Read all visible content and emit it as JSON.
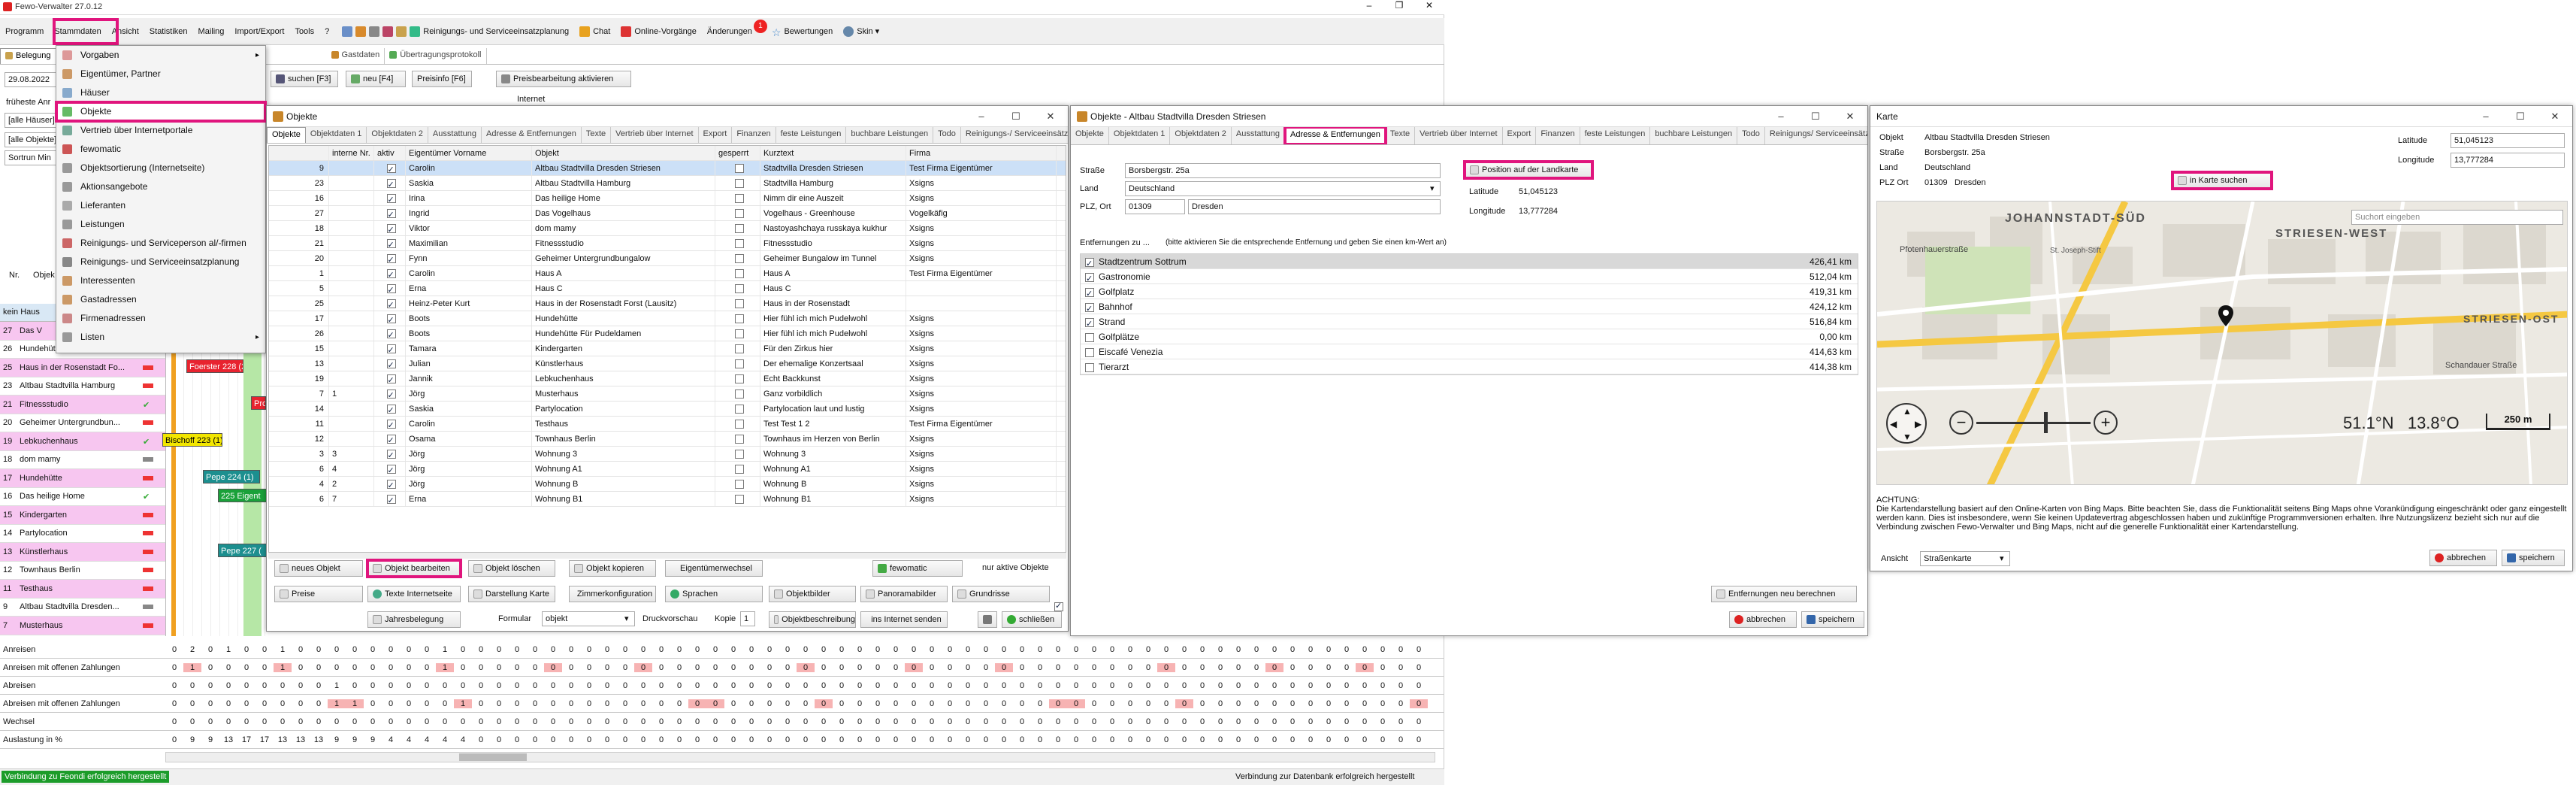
{
  "app": {
    "title": "Fewo-Verwalter 27.0.12"
  },
  "menubar": {
    "items": [
      "Programm",
      "Stammdaten",
      "Ansicht",
      "Statistiken",
      "Mailing",
      "Import/Export",
      "Tools",
      "?"
    ],
    "right": [
      "Reinigungs- und Serviceeinsatzplanung",
      "Chat",
      "Online-Vorgänge",
      "Änderungen",
      "Bewertungen",
      "Skin"
    ],
    "changes_badge": "1"
  },
  "stammdaten_menu": {
    "items": [
      "Vorgaben",
      "Eigentümer, Partner",
      "Häuser",
      "Objekte",
      "Vertrieb über Internetportale",
      "fewomatic",
      "Objektsortierung (Internetseite)",
      "Aktionsangebote",
      "Lieferanten",
      "Leistungen",
      "Reinigungs- und Serviceperson al/-firmen",
      "Reinigungs- und Serviceeinsatzplanung",
      "Interessenten",
      "Gastadressen",
      "Firmenadressen",
      "Listen"
    ]
  },
  "main": {
    "tabs": [
      "Belegung",
      "Gastdaten",
      "Übertragungsprotokoll"
    ],
    "toolbar": {
      "search": "suchen [F3]",
      "new": "neu [F4]",
      "prices": "Preisinfo [F6]",
      "price_edit": "Preisbearbeitung aktivieren",
      "internet": "Internet"
    },
    "date": "29.08.2022",
    "filters": [
      "[alle Häuser]",
      "[alle Objekte]"
    ],
    "fruehest": "früheste Anr",
    "sort": "Sortrun Min",
    "left_hdr": [
      "Nr.",
      "Objek"
    ],
    "house_row": "kein Haus",
    "rows": [
      {
        "nr": "27",
        "name": "Das V",
        "color": "#f7c6f0",
        "mark": "#e33"
      },
      {
        "nr": "26",
        "name": "Hundehütte Für Pudeldame",
        "color": "#fff",
        "mark": ""
      },
      {
        "nr": "25",
        "name": "Haus in der Rosenstadt Fo...",
        "color": "#f7c6f0",
        "mark": "#e33"
      },
      {
        "nr": "23",
        "name": "Altbau Stadtvilla Hamburg",
        "color": "#fff",
        "mark": "#e33"
      },
      {
        "nr": "21",
        "name": "Fitnessstudio",
        "color": "#f7c6f0",
        "mark": "#3a3"
      },
      {
        "nr": "20",
        "name": "Geheimer Untergrundbun...",
        "color": "#fff",
        "mark": "#e33"
      },
      {
        "nr": "19",
        "name": "Lebkuchenhaus",
        "color": "#f7c6f0",
        "mark": "#3a3"
      },
      {
        "nr": "18",
        "name": "dom mamy",
        "color": "#fff",
        "mark": "#888"
      },
      {
        "nr": "17",
        "name": "Hundehütte",
        "color": "#f7c6f0",
        "mark": "#e33"
      },
      {
        "nr": "16",
        "name": "Das heilige Home",
        "color": "#fff",
        "mark": "#3a3"
      },
      {
        "nr": "15",
        "name": "Kindergarten",
        "color": "#f7c6f0",
        "mark": "#e33"
      },
      {
        "nr": "14",
        "name": "Partylocation",
        "color": "#fff",
        "mark": "#e33"
      },
      {
        "nr": "13",
        "name": "Künstlerhaus",
        "color": "#f7c6f0",
        "mark": "#e33"
      },
      {
        "nr": "12",
        "name": "Townhaus Berlin",
        "color": "#fff",
        "mark": "#e33"
      },
      {
        "nr": "11",
        "name": "Testhaus",
        "color": "#f7c6f0",
        "mark": "#e33"
      },
      {
        "nr": "9",
        "name": "Altbau Stadtvilla Dresden...",
        "color": "#fff",
        "mark": "#888"
      },
      {
        "nr": "7",
        "name": "Musterhaus",
        "color": "#f7c6f0",
        "mark": "#e33"
      }
    ],
    "bookings": [
      {
        "label": "Foerster 228 (2)",
        "bg": "#e8232f",
        "fg": "#fff"
      },
      {
        "label": "Pro",
        "bg": "#e8232f",
        "fg": "#fff"
      },
      {
        "label": "Bischoff 223 (1)",
        "bg": "#f2e600",
        "fg": "#000"
      },
      {
        "label": "Pepe  224 (1)",
        "bg": "#1c8f8f",
        "fg": "#fff"
      },
      {
        "label": "225 Eigent",
        "bg": "#1aa13a",
        "fg": "#fff"
      },
      {
        "label": "Pepe  227 (",
        "bg": "#1c8f8f",
        "fg": "#fff"
      }
    ],
    "stats": [
      {
        "label": "Anreisen",
        "values": [
          "0",
          "2",
          "0",
          "1",
          "0",
          "0",
          "1",
          "0",
          "0",
          "0",
          "0",
          "0",
          "0",
          "0",
          "0",
          "1",
          "0",
          "0",
          "0",
          "0"
        ]
      },
      {
        "label": "Anreisen mit offenen Zahlungen",
        "values": [
          "0",
          "1",
          "0",
          "0",
          "0",
          "0",
          "1",
          "0",
          "0",
          "0",
          "0",
          "0",
          "0",
          "0",
          "0",
          "1",
          "0",
          "0",
          "0",
          "0"
        ]
      },
      {
        "label": "Abreisen",
        "values": [
          "0",
          "0",
          "0",
          "0",
          "0",
          "0",
          "0",
          "0",
          "0",
          "1",
          "0",
          "0",
          "0",
          "0",
          "0",
          "0",
          "0",
          "0",
          "0",
          "0"
        ]
      },
      {
        "label": "Abreisen mit offenen Zahlungen",
        "values": [
          "0",
          "0",
          "0",
          "0",
          "0",
          "0",
          "0",
          "0",
          "0",
          "1",
          "1",
          "0",
          "0",
          "0",
          "0",
          "0",
          "1",
          "0",
          "0",
          "0"
        ]
      },
      {
        "label": "Wechsel",
        "values": [
          "0",
          "0",
          "0",
          "0",
          "0",
          "0",
          "0",
          "0",
          "0",
          "0",
          "0",
          "0",
          "0",
          "0",
          "0",
          "0",
          "0",
          "0",
          "0",
          "0"
        ]
      },
      {
        "label": "Auslastung in %",
        "values": [
          "0",
          "9",
          "9",
          "13",
          "17",
          "17",
          "13",
          "13",
          "13",
          "9",
          "9",
          "9",
          "4",
          "4",
          "4",
          "4",
          "4",
          "0",
          "0",
          "0"
        ]
      }
    ]
  },
  "objekte": {
    "title": "Objekte",
    "tabs": [
      "Objekte",
      "Objektdaten 1",
      "Objektdaten 2",
      "Ausstattung",
      "Adresse & Entfernungen",
      "Texte",
      "Vertrieb über Internet",
      "Export",
      "Finanzen",
      "feste Leistungen",
      "buchbare Leistungen",
      "Todo",
      "Reinigungs-/ Serviceeinsätze"
    ],
    "cols": [
      "interne Nr.",
      "aktiv",
      "Eigentümer Vorname",
      "Objekt",
      "gesperrt",
      "Kurztext",
      "Firma"
    ],
    "rows": [
      {
        "nr": "9",
        "inr": "",
        "fn": "Carolin",
        "obj": "Altbau Stadtvilla Dresden Striesen",
        "kurz": "Stadtvilla Dresden Striesen",
        "firma": "Test Firma Eigentümer"
      },
      {
        "nr": "23",
        "inr": "",
        "fn": "Saskia",
        "obj": "Altbau Stadtvilla Hamburg",
        "kurz": "Stadtvilla Hamburg",
        "firma": "Xsigns"
      },
      {
        "nr": "16",
        "inr": "",
        "fn": "Irina",
        "obj": "Das heilige Home",
        "kurz": "Nimm dir eine Auszeit",
        "firma": "Xsigns"
      },
      {
        "nr": "27",
        "inr": "",
        "fn": "Ingrid",
        "obj": "Das Vogelhaus",
        "kurz": "Vogelhaus - Greenhouse",
        "firma": "Vogelkäfig"
      },
      {
        "nr": "18",
        "inr": "",
        "fn": "Viktor",
        "obj": "dom mamy",
        "kurz": "Nastoyashchaya russkaya kukhur",
        "firma": "Xsigns"
      },
      {
        "nr": "21",
        "inr": "",
        "fn": "Maximilian",
        "obj": "Fitnessstudio",
        "kurz": "Fitnessstudio",
        "firma": "Xsigns"
      },
      {
        "nr": "20",
        "inr": "",
        "fn": "Fynn",
        "obj": "Geheimer Untergrundbungalow",
        "kurz": "Geheimer Bungalow im Tunnel",
        "firma": "Xsigns"
      },
      {
        "nr": "1",
        "inr": "",
        "fn": "Carolin",
        "obj": "Haus A",
        "kurz": "Haus A",
        "firma": "Test Firma Eigentümer"
      },
      {
        "nr": "5",
        "inr": "",
        "fn": "Erna",
        "obj": "Haus C",
        "kurz": "Haus C",
        "firma": ""
      },
      {
        "nr": "25",
        "inr": "",
        "fn": "Heinz-Peter Kurt",
        "obj": "Haus in der Rosenstadt Forst (Lausitz)",
        "kurz": "Haus in der Rosenstadt",
        "firma": ""
      },
      {
        "nr": "17",
        "inr": "",
        "fn": "Boots",
        "obj": "Hundehütte",
        "kurz": "Hier fühl ich mich Pudelwohl",
        "firma": "Xsigns"
      },
      {
        "nr": "26",
        "inr": "",
        "fn": "Boots",
        "obj": "Hundehütte Für Pudeldamen",
        "kurz": "Hier fühl ich mich Pudelwohl",
        "firma": "Xsigns"
      },
      {
        "nr": "15",
        "inr": "",
        "fn": "Tamara",
        "obj": "Kindergarten",
        "kurz": "Für den Zirkus hier",
        "firma": "Xsigns"
      },
      {
        "nr": "13",
        "inr": "",
        "fn": "Julian",
        "obj": "Künstlerhaus",
        "kurz": "Der ehemalige Konzertsaal",
        "firma": "Xsigns"
      },
      {
        "nr": "19",
        "inr": "",
        "fn": "Jannik",
        "obj": "Lebkuchenhaus",
        "kurz": "Echt Backkunst",
        "firma": "Xsigns"
      },
      {
        "nr": "7",
        "inr": "1",
        "fn": "Jörg",
        "obj": "Musterhaus",
        "kurz": "Ganz vorbildlich",
        "firma": "Xsigns"
      },
      {
        "nr": "14",
        "inr": "",
        "fn": "Saskia",
        "obj": "Partylocation",
        "kurz": "Partylocation laut und lustig",
        "firma": "Xsigns"
      },
      {
        "nr": "11",
        "inr": "",
        "fn": "Carolin",
        "obj": "Testhaus",
        "kurz": "Test Test 1 2",
        "firma": "Test Firma Eigentümer"
      },
      {
        "nr": "12",
        "inr": "",
        "fn": "Osama",
        "obj": "Townhaus Berlin",
        "kurz": "Townhaus im Herzen von Berlin",
        "firma": "Xsigns"
      },
      {
        "nr": "3",
        "inr": "3",
        "fn": "Jörg",
        "obj": "Wohnung 3",
        "kurz": "Wohnung 3",
        "firma": "Xsigns"
      },
      {
        "nr": "6",
        "inr": "4",
        "fn": "Jörg",
        "obj": "Wohnung A1",
        "kurz": "Wohnung A1",
        "firma": "Xsigns"
      },
      {
        "nr": "4",
        "inr": "2",
        "fn": "Jörg",
        "obj": "Wohnung B",
        "kurz": "Wohnung B",
        "firma": "Xsigns"
      },
      {
        "nr": "6",
        "inr": "7",
        "fn": "Erna",
        "obj": "Wohnung B1",
        "kurz": "Wohnung B1",
        "firma": "Xsigns"
      }
    ],
    "buttons": {
      "new": "neues Objekt",
      "edit": "Objekt bearbeiten",
      "delete": "Objekt löschen",
      "copy": "Objekt kopieren",
      "owner": "Eigentümerwechsel",
      "fewomatic": "fewomatic",
      "active_only": "nur aktive Objekte",
      "prices": "Preise",
      "texts": "Texte Internetseite",
      "map": "Darstellung Karte",
      "rooms": "Zimmerkonfiguration",
      "lang": "Sprachen",
      "pics": "Objektbilder",
      "pano": "Panoramabilder",
      "plan": "Grundrisse",
      "yearly": "Jahresbelegung",
      "formular": "Formular",
      "formular_val": "objekt",
      "preview": "Druckvorschau",
      "kopie": "Kopie",
      "kopie_val": "1",
      "describe": "Objektbeschreibung",
      "send": "ins Internet senden",
      "close": "schließen"
    }
  },
  "detail": {
    "title": "Objekte - Altbau Stadtvilla Dresden Striesen",
    "tabs": [
      "Objekte",
      "Objektdaten 1",
      "Objektdaten 2",
      "Ausstattung",
      "Adresse & Entfernungen",
      "Texte",
      "Vertrieb über Internet",
      "Export",
      "Finanzen",
      "feste Leistungen",
      "buchbare Leistungen",
      "Todo",
      "Reinigungs/ Serviceeinsätze"
    ],
    "strasse_lbl": "Straße",
    "strasse": "Borsbergstr. 25a",
    "land_lbl": "Land",
    "land": "Deutschland",
    "plz_lbl": "PLZ, Ort",
    "plz": "01309",
    "ort": "Dresden",
    "map_btn": "Position auf der Landkarte",
    "lat_lbl": "Latitude",
    "lat": "51,045123",
    "lon_lbl": "Longitude",
    "lon": "13,777284",
    "dist_hdr": "Entfernungen zu ...",
    "dist_hint": "(bitte aktivieren Sie die entsprechende Entfernung und geben Sie einen km-Wert an)",
    "distances": [
      {
        "name": "Stadtzentrum Sottrum",
        "km": "426,41 km",
        "on": true
      },
      {
        "name": "Gastronomie",
        "km": "512,04 km",
        "on": true
      },
      {
        "name": "Golfplatz",
        "km": "419,31 km",
        "on": true
      },
      {
        "name": "Bahnhof",
        "km": "424,12 km",
        "on": true
      },
      {
        "name": "Strand",
        "km": "516,84 km",
        "on": true
      },
      {
        "name": "Golfplätze",
        "km": "0,00 km",
        "on": false
      },
      {
        "name": "Eiscafé Venezia",
        "km": "414,63 km",
        "on": false
      },
      {
        "name": "Tierarzt",
        "km": "414,38 km",
        "on": false
      }
    ],
    "recalc": "Entfernungen neu berechnen",
    "cancel": "abbrechen",
    "save": "speichern"
  },
  "karte": {
    "title": "Karte",
    "objekt_lbl": "Objekt",
    "objekt": "Altbau Stadtvilla Dresden Striesen",
    "strasse_lbl": "Straße",
    "strasse": "Borsbergstr. 25a",
    "land_lbl": "Land",
    "land": "Deutschland",
    "plz_lbl": "PLZ Ort",
    "plz": "01309",
    "ort": "Dresden",
    "lat_lbl": "Latitude",
    "lat": "51,045123",
    "lon_lbl": "Longitude",
    "lon": "13,777284",
    "search_btn": "in Karte suchen",
    "search_ph": "Suchort eingeben",
    "map_labels": [
      "JOHANNSTADT-SÜD",
      "STRIESEN-WEST",
      "STRIESEN-OST",
      "Schandauer Straße",
      "Pfotenhauerstraße",
      "St. Joseph-Stift"
    ],
    "coords": "51.1°N   13.8°O",
    "scale": "250 m",
    "note_title": "ACHTUNG:",
    "note": "Die Kartendarstellung basiert auf den Online-Karten von Bing Maps. Bitte beachten Sie, dass die Funktionalität seitens Bing Maps ohne Vorankündigung eingeschränkt oder ganz eingestellt werden kann. Dies ist insbesondere, wenn Sie keinen Updatevertrag abgeschlossen haben und zukünftige Programmversionen erhalten. Ihre Nutzungslizenz bezieht sich nur auf die Verbindung zwischen Fewo-Verwalter und Bing Maps, nicht auf die generelle Funktionalität einer Kartendarstellung.",
    "view_lbl": "Ansicht",
    "view": "Straßenkarte",
    "cancel": "abbrechen",
    "save": "speichern"
  },
  "statusbar": {
    "left": "Verbindung zu Feondi erfolgreich hergestellt",
    "right": "Verbindung zur Datenbank erfolgreich hergestellt"
  }
}
